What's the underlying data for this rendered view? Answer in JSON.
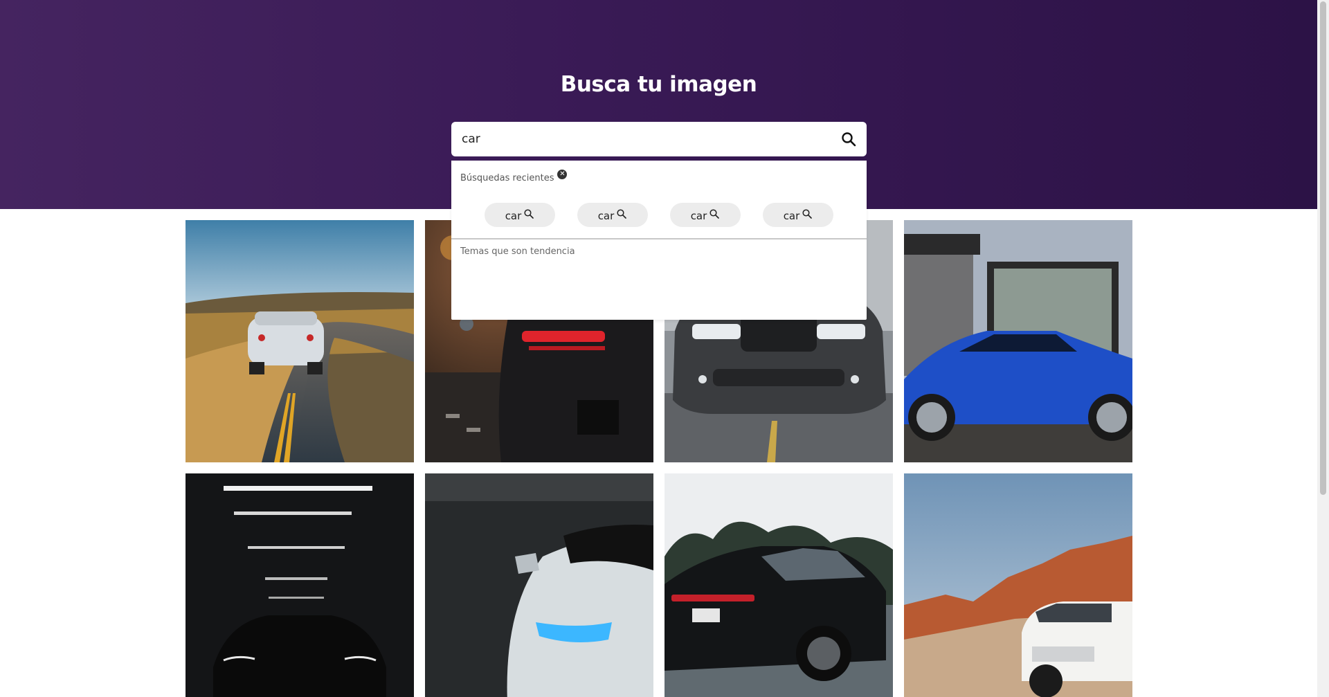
{
  "header": {
    "title": "Busca tu imagen"
  },
  "search": {
    "value": "car",
    "button_icon": "search-icon"
  },
  "dropdown": {
    "recent_title": "Búsquedas recientes",
    "clear_icon": "close-circle-icon",
    "recent_items": [
      {
        "label": "car",
        "icon": "search-icon"
      },
      {
        "label": "car",
        "icon": "search-icon"
      },
      {
        "label": "car",
        "icon": "search-icon"
      },
      {
        "label": "car",
        "icon": "search-icon"
      }
    ],
    "trending_title": "Temas que son tendencia"
  },
  "gallery": {
    "images": [
      {
        "subject": "white sports car on winding road at sunset"
      },
      {
        "subject": "black car with red tail lights at night"
      },
      {
        "subject": "dark grey muscle car front view on road"
      },
      {
        "subject": "blue coupe parked in front of garage"
      },
      {
        "subject": "black car in dark parking garage under lights"
      },
      {
        "subject": "white car with blue headlights in garage"
      },
      {
        "subject": "black sedan driving on road"
      },
      {
        "subject": "white SUV in desert with red rocks"
      }
    ]
  },
  "colors": {
    "header_start": "#452460",
    "header_end": "#2c1246",
    "chip_bg": "#ececec"
  }
}
